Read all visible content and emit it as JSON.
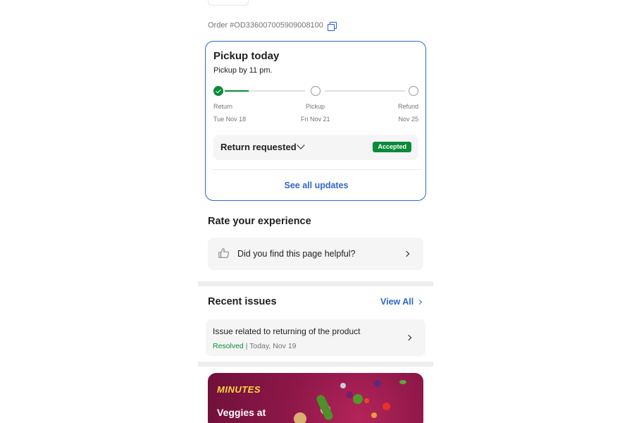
{
  "order": {
    "label": "Order #OD336007005909008100"
  },
  "tracking": {
    "title": "Pickup today",
    "subtitle": "Pickup by 11 pm.",
    "steps": [
      {
        "label": "Return",
        "date": "Tue Nov 18",
        "done": true
      },
      {
        "label": "Pickup",
        "date": "Fri Nov 21",
        "done": false
      },
      {
        "label": "Refund",
        "date": "Nov 25",
        "done": false
      }
    ],
    "progress_first_segment_fraction": 0.3,
    "return_status": {
      "label": "Return requested",
      "badge": "Accepted"
    },
    "see_all": "See all updates"
  },
  "rating": {
    "title": "Rate your experience",
    "prompt": "Did you find this page helpful?"
  },
  "recent_issues": {
    "title": "Recent issues",
    "view_all": "View All",
    "items": [
      {
        "title": "Issue related to returning of the product",
        "status": "Resolved",
        "separator": "|",
        "date": "Today, Nov 19"
      }
    ]
  },
  "promo": {
    "brand": "MINUTES",
    "headline": "Veggies at"
  },
  "colors": {
    "accent": "#2f67c9",
    "success": "#0b8a3a",
    "promo_bg": "#8d1748",
    "promo_brand": "#ffd83a"
  },
  "icons": {
    "copy": "copy-icon",
    "check": "check-icon",
    "thumb": "thumbs-up-icon",
    "chevron_down": "chevron-down-icon",
    "chevron_right": "chevron-right-icon"
  }
}
